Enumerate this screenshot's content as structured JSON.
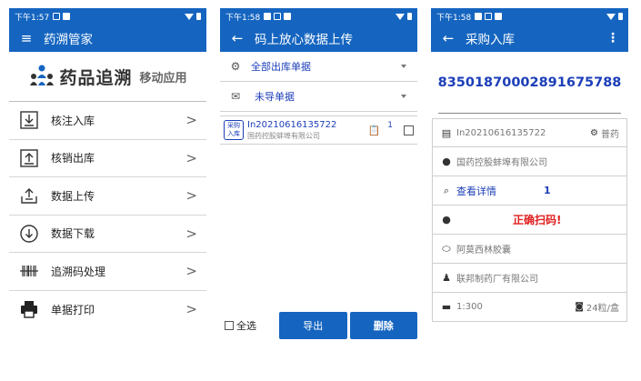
{
  "screens": [
    {
      "status_time": "下午1:57",
      "title": "药溯管家",
      "header_title": "药品追溯",
      "header_subtitle": "移动应用",
      "menu": [
        {
          "label": "核注入库",
          "icon": "download-box-icon"
        },
        {
          "label": "核销出库",
          "icon": "upload-box-icon"
        },
        {
          "label": "数据上传",
          "icon": "tray-upload-icon"
        },
        {
          "label": "数据下载",
          "icon": "circle-download-icon"
        },
        {
          "label": "追溯码处理",
          "icon": "barcode-icon"
        },
        {
          "label": "单据打印",
          "icon": "printer-icon"
        }
      ]
    },
    {
      "status_time": "下午1:58",
      "title": "码上放心数据上传",
      "filter_scope": "全部出库单据",
      "filter_status": "未导单据",
      "items": [
        {
          "badge": "采购入库",
          "code": "In20210616135722",
          "company": "国药控股蚌埠有限公司",
          "count": "1"
        }
      ],
      "select_all_label": "全选",
      "export_label": "导出",
      "delete_label": "删除"
    },
    {
      "status_time": "下午1:58",
      "title": "采购入库",
      "menu_icon": "⋮",
      "trace_code": "83501870002891675788",
      "doc_no": "In20210616135722",
      "drug_type": "普药",
      "supplier": "国药控股蚌埠有限公司",
      "detail_label": "查看详情",
      "detail_count": "1",
      "scan_status": "正确扫码!",
      "drug_name": "阿莫西林胶囊",
      "manufacturer": "联邦制药厂有限公司",
      "package_ratio": "1:300",
      "spec": "24粒/盒"
    }
  ],
  "colors": {
    "primary": "#1565c0",
    "link": "#1c3fb8",
    "error": "#e02020"
  }
}
